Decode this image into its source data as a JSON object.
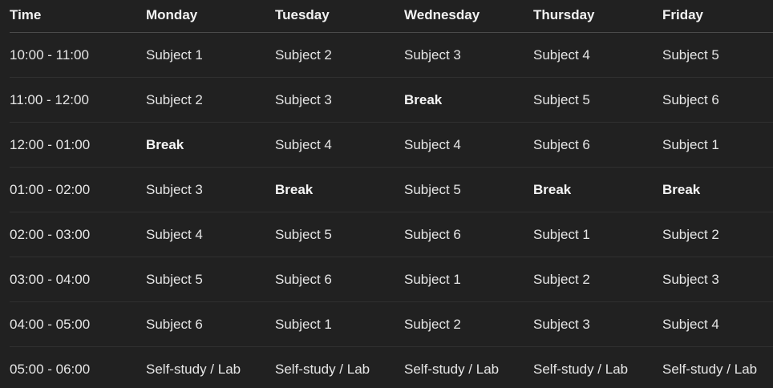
{
  "table": {
    "headers": [
      "Time",
      "Monday",
      "Tuesday",
      "Wednesday",
      "Thursday",
      "Friday"
    ],
    "rows": [
      [
        "10:00 - 11:00",
        "Subject 1",
        "Subject 2",
        "Subject 3",
        "Subject 4",
        "Subject 5"
      ],
      [
        "11:00 - 12:00",
        "Subject 2",
        "Subject 3",
        "Break",
        "Subject 5",
        "Subject 6"
      ],
      [
        "12:00 - 01:00",
        "Break",
        "Subject 4",
        "Subject 4",
        "Subject 6",
        "Subject 1"
      ],
      [
        "01:00 - 02:00",
        "Subject 3",
        "Break",
        "Subject 5",
        "Break",
        "Break"
      ],
      [
        "02:00 - 03:00",
        "Subject 4",
        "Subject 5",
        "Subject 6",
        "Subject 1",
        "Subject 2"
      ],
      [
        "03:00 - 04:00",
        "Subject 5",
        "Subject 6",
        "Subject 1",
        "Subject 2",
        "Subject 3"
      ],
      [
        "04:00 - 05:00",
        "Subject 6",
        "Subject 1",
        "Subject 2",
        "Subject 3",
        "Subject 4"
      ],
      [
        "05:00 - 06:00",
        "Self-study / Lab",
        "Self-study / Lab",
        "Self-study / Lab",
        "Self-study / Lab",
        "Self-study / Lab"
      ]
    ]
  },
  "colors": {
    "background": "#212121",
    "text": "#e6e6e6",
    "header_divider": "#4a4a4a",
    "row_divider": "#303030"
  }
}
